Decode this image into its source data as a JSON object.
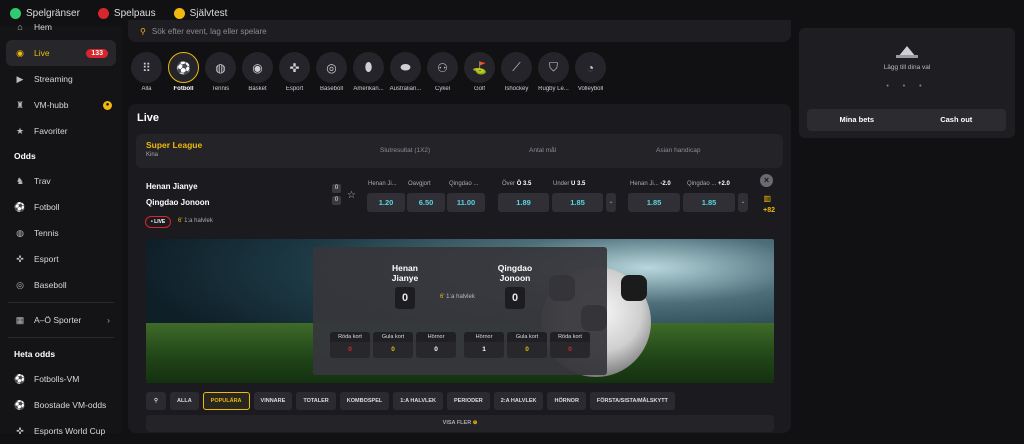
{
  "topbar": {
    "items": [
      {
        "label": "Spelgränser",
        "icon": "limits-icon",
        "color": "#2ecc71"
      },
      {
        "label": "Spelpaus",
        "icon": "pause-icon",
        "color": "#d9262e"
      },
      {
        "label": "Självtest",
        "icon": "test-icon",
        "color": "#f0b90b"
      }
    ]
  },
  "sidebar": {
    "items": [
      {
        "label": "Hem",
        "icon": "home-icon"
      },
      {
        "label": "Live",
        "icon": "live-icon",
        "badge": "133"
      },
      {
        "label": "Streaming",
        "icon": "streaming-icon"
      },
      {
        "label": "VM-hubb",
        "icon": "trophy-icon"
      },
      {
        "label": "Favoriter",
        "icon": "star-icon"
      }
    ],
    "odds_header": "Odds",
    "odds_items": [
      {
        "label": "Trav",
        "icon": "horse-icon"
      },
      {
        "label": "Fotboll",
        "icon": "football-icon"
      },
      {
        "label": "Tennis",
        "icon": "tennis-icon"
      },
      {
        "label": "Esport",
        "icon": "gamepad-icon"
      },
      {
        "label": "Baseboll",
        "icon": "baseball-icon"
      }
    ],
    "az_label": "A–Ö Sporter",
    "heta_header": "Heta odds",
    "heta_items": [
      {
        "label": "Fotbolls-VM",
        "icon": "football-icon"
      },
      {
        "label": "Boostade VM-odds",
        "icon": "football-icon"
      },
      {
        "label": "Esports World Cup",
        "icon": "gamepad-icon"
      }
    ]
  },
  "search": {
    "placeholder": "Sök efter event, lag eller spelare"
  },
  "sports": [
    {
      "label": "Alla",
      "icon": "grid-icon"
    },
    {
      "label": "Fotboll",
      "icon": "football-icon"
    },
    {
      "label": "Tennis",
      "icon": "tennis-icon"
    },
    {
      "label": "Basket",
      "icon": "basketball-icon"
    },
    {
      "label": "Esport",
      "icon": "gamepad-icon"
    },
    {
      "label": "Baseboll",
      "icon": "baseball-icon"
    },
    {
      "label": "Amerikan...",
      "icon": "american-football-icon"
    },
    {
      "label": "Australian...",
      "icon": "rugby-ball-icon"
    },
    {
      "label": "Cykel",
      "icon": "bicycle-icon"
    },
    {
      "label": "Golf",
      "icon": "golf-icon"
    },
    {
      "label": "Ishockey",
      "icon": "hockey-icon"
    },
    {
      "label": "Rugby Le...",
      "icon": "rugby-icon"
    },
    {
      "label": "Volleyboll",
      "icon": "volleyball-icon"
    }
  ],
  "live": {
    "title": "Live",
    "league": "Super League",
    "country": "Kina",
    "col_headers": [
      "Slutresultat (1X2)",
      "Antal mål",
      "Asian handicap"
    ],
    "home": "Henan Jianye",
    "away": "Qingdao Jonoon",
    "home_score": "0",
    "away_score": "0",
    "market_heads": {
      "h1": "Henan Ji...",
      "hx": "Oavgjort",
      "h2": "Qingdao ...",
      "over": "Över",
      "over_line": "Ö 3.5",
      "under": "Under",
      "under_line": "U 3.5",
      "ah1": "Henan Ji...",
      "ah1_line": "-2.0",
      "ah2": "Qingdao ...",
      "ah2_line": "+2.0"
    },
    "odds": [
      "1.20",
      "6.50",
      "11.00",
      "1.89",
      "1.85",
      "1.85",
      "1.85"
    ],
    "more_markets": "+82",
    "live_badge": "• LIVE",
    "minute": "6'",
    "period": "1:a halvlek"
  },
  "scoreboard": {
    "home_line1": "Henan",
    "home_line2": "Jianye",
    "away_line1": "Qingdao",
    "away_line2": "Jonoon",
    "home_score": "0",
    "away_score": "0",
    "minute": "6'",
    "period": "1:a halvlek",
    "stats": [
      {
        "label": "Röda kort",
        "value": "0",
        "color": "#d9262e"
      },
      {
        "label": "Gula kort",
        "value": "0",
        "color": "#f0b90b"
      },
      {
        "label": "Hörnor",
        "value": "0",
        "color": "#ffffff"
      },
      {
        "label": "Hörnor",
        "value": "1",
        "color": "#ffffff"
      },
      {
        "label": "Gula kort",
        "value": "0",
        "color": "#f0b90b"
      },
      {
        "label": "Röda kort",
        "value": "0",
        "color": "#d9262e"
      }
    ]
  },
  "filters": [
    "ALLA",
    "POPULÄRA",
    "VINNARE",
    "TOTALER",
    "KOMBOSPEL",
    "1:A HALVLEK",
    "PERIODER",
    "2:A HALVLEK",
    "HÖRNOR",
    "FÖRSTA/SISTA/MÅLSKYTT"
  ],
  "show_more": "VISA FLER",
  "betslip": {
    "empty_text": "Lägg till dina val",
    "dots": "• • •",
    "tab1": "Mina bets",
    "tab2": "Cash out"
  },
  "colors": {
    "accent": "#f0b90b",
    "odds": "#5ad4e0",
    "live": "#d9262e"
  }
}
